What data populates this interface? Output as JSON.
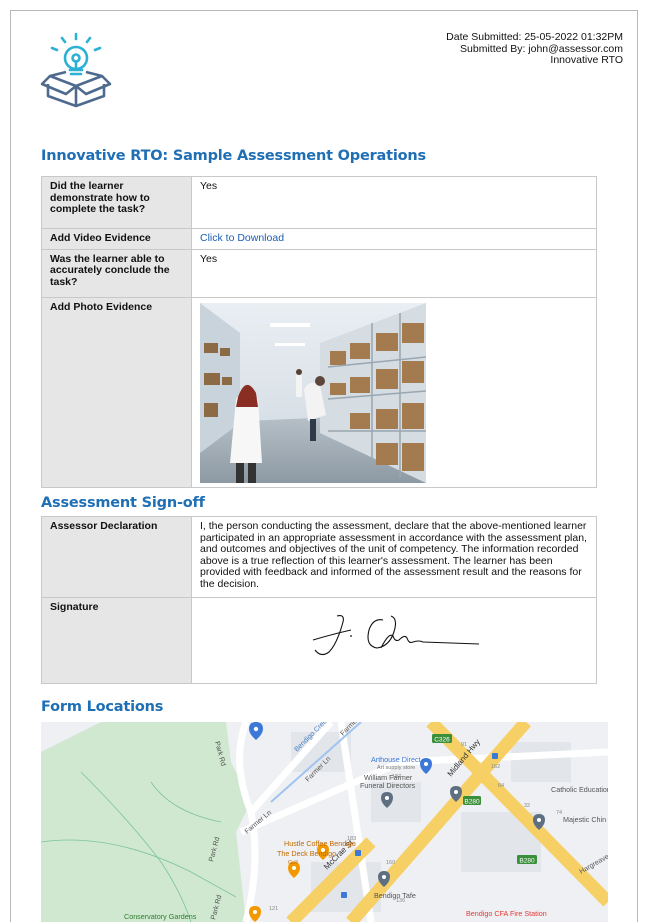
{
  "header": {
    "date_submitted": "Date Submitted: 25-05-2022 01:32PM",
    "submitted_by": "Submitted By: john@assessor.com",
    "organization": "Innovative RTO"
  },
  "sections": {
    "operations_title": "Innovative RTO: Sample Assessment Operations",
    "signoff_title": "Assessment Sign-off",
    "locations_title": "Form Locations"
  },
  "operations": {
    "q1_label": "Did the learner demonstrate how to complete the task?",
    "q1_value": "Yes",
    "video_label": "Add Video Evidence",
    "video_value": "Click to Download",
    "q2_label": "Was the learner able to accurately conclude the task?",
    "q2_value": "Yes",
    "photo_label": "Add Photo Evidence"
  },
  "signoff": {
    "declaration_label": "Assessor Declaration",
    "declaration_text": "I, the person conducting the assessment, declare that the above-mentioned learner participated in an appropriate assessment in accordance with the assessment plan, and outcomes and objectives of the unit of competency. The information recorded above is a true reflection of this learner's assessment. The learner has been provided with feedback and informed of the assessment result and the reasons for the decision.",
    "signature_label": "Signature"
  },
  "map": {
    "roads": {
      "park_rd": "Park Rd",
      "farmer_ln": "Farmer Ln",
      "mccrae_st": "McCrae St",
      "midland_hwy": "Midland Hwy",
      "bendigo_creek": "Bendigo Creek",
      "hargreaves": "Hargreaves",
      "farmer_st": "Farmer"
    },
    "badges": {
      "c326": "C326",
      "b280": "B280",
      "b280b": "B280"
    },
    "places": {
      "arthouse": "Arthouse Direct",
      "arthouse_sub": "Art supply store",
      "funeral_1": "William Farmer",
      "funeral_2": "Funeral Directors",
      "catholic": "Catholic Education O",
      "majestic": "Majestic Chin",
      "hustle": "Hustle Coffee Bendigo",
      "deck": "The Deck Bendigo",
      "grill": "Grill",
      "tafe": "Bendigo Tafe",
      "cfa": "Bendigo CFA Fire Station",
      "gardens": "Conservatory Gardens"
    },
    "numbers": {
      "n187": "187",
      "n91": "91",
      "n162": "162",
      "n64": "64",
      "n32": "32",
      "n74": "74",
      "n183": "183",
      "n160": "160",
      "n114": "114",
      "n121": "121",
      "n136": "136"
    },
    "colors": {
      "highway": "#f6cf65",
      "park": "#c8e6c9",
      "water": "#a0c3f0",
      "marker": "#5f6f82",
      "food": "#f29900",
      "cfa": "#e53935"
    }
  }
}
